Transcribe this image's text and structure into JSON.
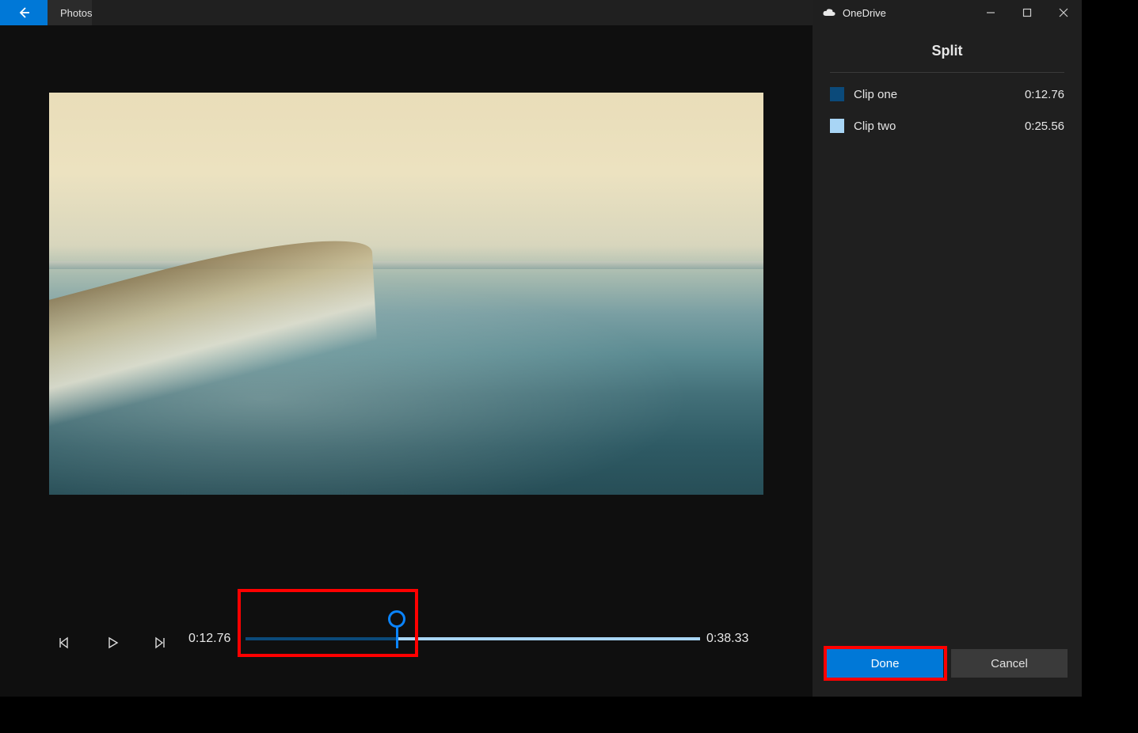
{
  "titlebar": {
    "app_name": "Photos",
    "cloud_label": "OneDrive"
  },
  "panel": {
    "title": "Split",
    "clips": [
      {
        "label": "Clip one",
        "duration": "0:12.76",
        "swatch": "#0b4a7a"
      },
      {
        "label": "Clip two",
        "duration": "0:25.56",
        "swatch": "#a8d5f5"
      }
    ],
    "done_label": "Done",
    "cancel_label": "Cancel"
  },
  "timeline": {
    "current": "0:12.76",
    "total": "0:38.33",
    "split_fraction": 0.333
  }
}
